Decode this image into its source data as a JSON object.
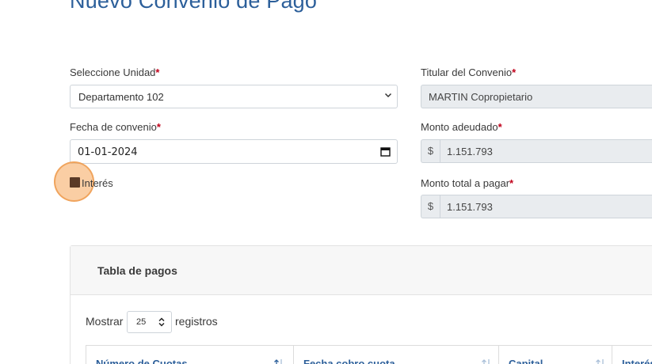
{
  "page": {
    "title": "Nuevo Convenio de Pago"
  },
  "form": {
    "unidad": {
      "label": "Seleccione Unidad",
      "required_mark": "*",
      "value": "Departamento 102"
    },
    "fecha": {
      "label": "Fecha de convenio",
      "required_mark": "*",
      "value": "01-01-2024"
    },
    "interes": {
      "label": "Interés",
      "checked": true
    },
    "titular": {
      "label": "Titular del Convenio",
      "required_mark": "*",
      "value": "MARTIN Copropietario"
    },
    "monto_adeudado": {
      "label": "Monto adeudado",
      "required_mark": "*",
      "currency": "$",
      "value": "1.151.793"
    },
    "monto_total": {
      "label": "Monto total a pagar",
      "required_mark": "*",
      "currency": "$",
      "value": "1.151.793"
    }
  },
  "table": {
    "title": "Tabla de pagos",
    "length_prefix": "Mostrar",
    "length_value": "25",
    "length_suffix": "registros",
    "columns": [
      "Número de Cuotas",
      "Fecha cobro cuota",
      "Capital",
      "Interés"
    ]
  },
  "icons": {
    "select_chevron": "chevron-down-icon",
    "calendar": "calendar-icon",
    "sort": "sort-icon"
  },
  "colors": {
    "title": "#2c5f9a",
    "required": "#c0001a",
    "checkbox": "#5a3a26",
    "cursor": "#f5a65a"
  }
}
